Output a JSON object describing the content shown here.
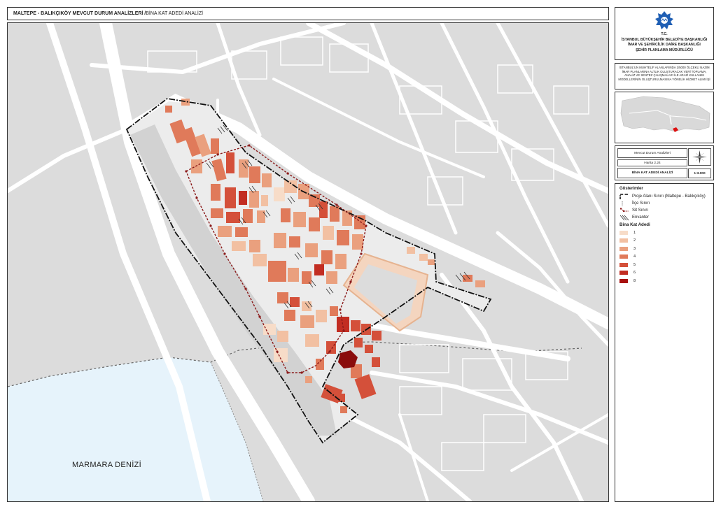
{
  "header": {
    "title_main": "MALTEPE - BALIKÇIKÖY MEVCUT DURUM ANALİZLERİ /",
    "title_sub": " BİNA KAT ADEDİ ANALİZİ"
  },
  "institution": {
    "tc": "T.C.",
    "line1": "İSTANBUL BÜYÜKŞEHİR BELEDİYE BAŞKANLIĞI",
    "line2": "İMAR VE ŞEHİRCİLİK DAİRE BAŞKANLIĞI",
    "line3": "ŞEHİR PLANLAMA MÜDÜRLÜĞÜ"
  },
  "project_desc": "İSTANBUL'UN MUHTELİF ALANLARINDA 1/5000 ÖLÇEKLİ NAZIM İMAR PLANLARINA ALTLIK OLUŞTURACAK VERİ TOPLAMA, ANALİZ VE SENTEZ ÇALIŞMALARI İLE ARAZİ KULLANIM MODELLERİNİN OLUŞTURULMASINA YÖNELİK HİZMET ALIMI İŞİ",
  "info": {
    "study": "Mevcut Durum Analizleri",
    "map_no": "Harita 2.24",
    "map_name": "BİNA KAT ADEDİ ANALİZİ",
    "scale": "1:3.000"
  },
  "legend": {
    "title": "Gösterimler",
    "items": [
      {
        "label": "Proje Alanı Sınırı (Maltepe - Balıkçıköy)",
        "symbol": "project-boundary"
      },
      {
        "label": "İlçe Sınırı",
        "symbol": "district-boundary"
      },
      {
        "label": "Sit Sınırı",
        "symbol": "site-boundary"
      },
      {
        "label": "Envanter",
        "symbol": "inventory-hatch"
      }
    ],
    "floors_title": "Bina Kat Adedi",
    "floors": [
      {
        "label": "1",
        "color": "#f7dcc8"
      },
      {
        "label": "2",
        "color": "#f2c0a2"
      },
      {
        "label": "3",
        "color": "#eaa07e"
      },
      {
        "label": "4",
        "color": "#e07a5a"
      },
      {
        "label": "5",
        "color": "#d4503a"
      },
      {
        "label": "6",
        "color": "#c22d22"
      },
      {
        "label": "8",
        "color": "#a8100f"
      }
    ]
  },
  "map": {
    "sea_label": "MARMARA DENİZİ",
    "colors": {
      "land": "#dcdcdc",
      "road": "#ffffff",
      "sea": "#e6f3fb",
      "site": "#8b1a1a"
    }
  }
}
